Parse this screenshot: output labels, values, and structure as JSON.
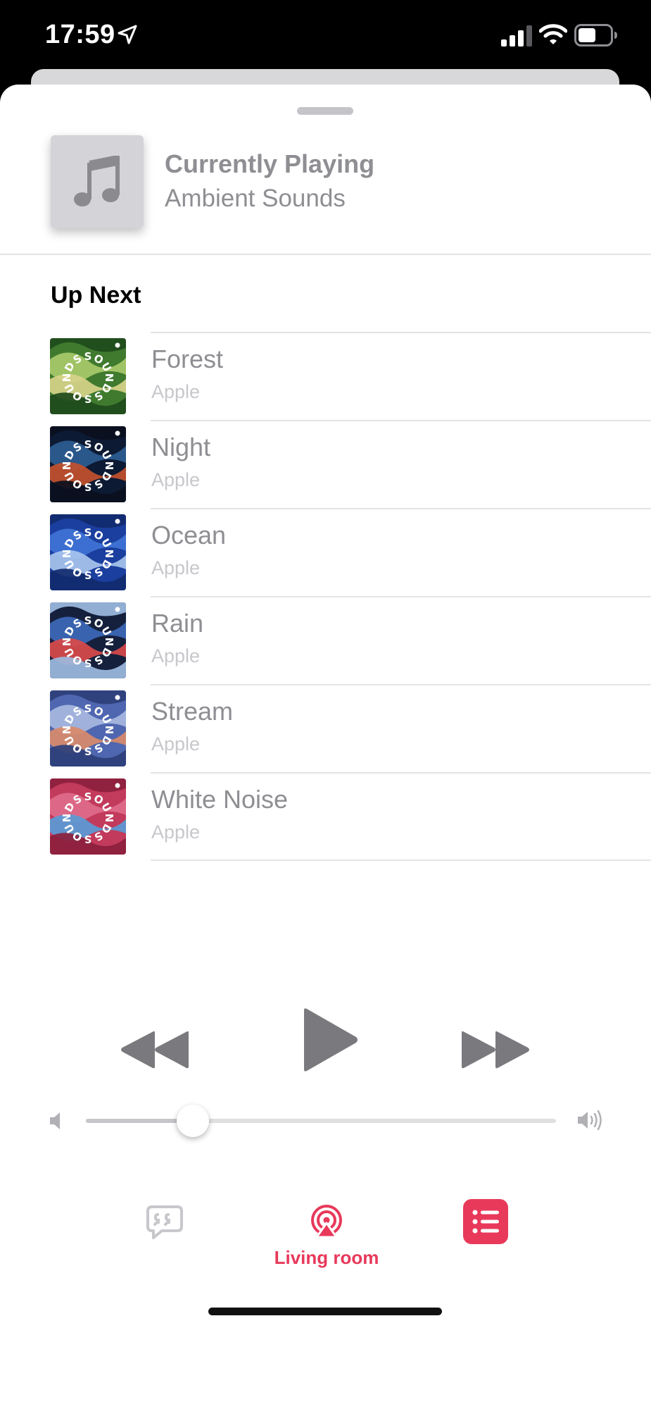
{
  "status_bar": {
    "time": "17:59",
    "icons": [
      "location-arrow-icon",
      "cellular-signal-icon",
      "wifi-icon",
      "battery-icon"
    ]
  },
  "now_playing": {
    "title": "Currently Playing",
    "subtitle": "Ambient Sounds",
    "art_icon": "music-note-icon"
  },
  "up_next": {
    "heading": "Up Next",
    "items": [
      {
        "title": "Forest",
        "artist": "Apple",
        "art_colors": [
          "#3f7a2e",
          "#a8c96a",
          "#d6d28a",
          "#1e4a1c"
        ]
      },
      {
        "title": "Night",
        "artist": "Apple",
        "art_colors": [
          "#0d1a33",
          "#2c5d92",
          "#c2502c",
          "#0a0f1e"
        ]
      },
      {
        "title": "Ocean",
        "artist": "Apple",
        "art_colors": [
          "#1b3f9e",
          "#3f73d6",
          "#a8c4ee",
          "#112a6e"
        ]
      },
      {
        "title": "Rain",
        "artist": "Apple",
        "art_colors": [
          "#15203d",
          "#3d69b8",
          "#d94a4a",
          "#9dbbe0"
        ]
      },
      {
        "title": "Stream",
        "artist": "Apple",
        "art_colors": [
          "#4f66b0",
          "#a7b8df",
          "#d98a6a",
          "#2e3f7a"
        ]
      },
      {
        "title": "White Noise",
        "artist": "Apple",
        "art_colors": [
          "#c23a5c",
          "#e06b8a",
          "#5a9bd6",
          "#8c1f3d"
        ]
      }
    ],
    "art_text": "SOUNDS"
  },
  "transport": {
    "rewind_icon": "rewind-icon",
    "play_icon": "play-icon",
    "fast_forward_icon": "fast-forward-icon"
  },
  "volume": {
    "level": 0.227,
    "min_icon": "speaker-low-icon",
    "max_icon": "speaker-high-icon"
  },
  "bottom_bar": {
    "lyrics_icon": "lyrics-bubble-icon",
    "airplay_label": "Living room",
    "airplay_icon": "airplay-audio-icon",
    "queue_icon": "queue-list-icon"
  },
  "colors": {
    "accent": "#e8395b",
    "secondary_text": "#8e8e93",
    "tertiary_text": "#c7c7cc"
  }
}
